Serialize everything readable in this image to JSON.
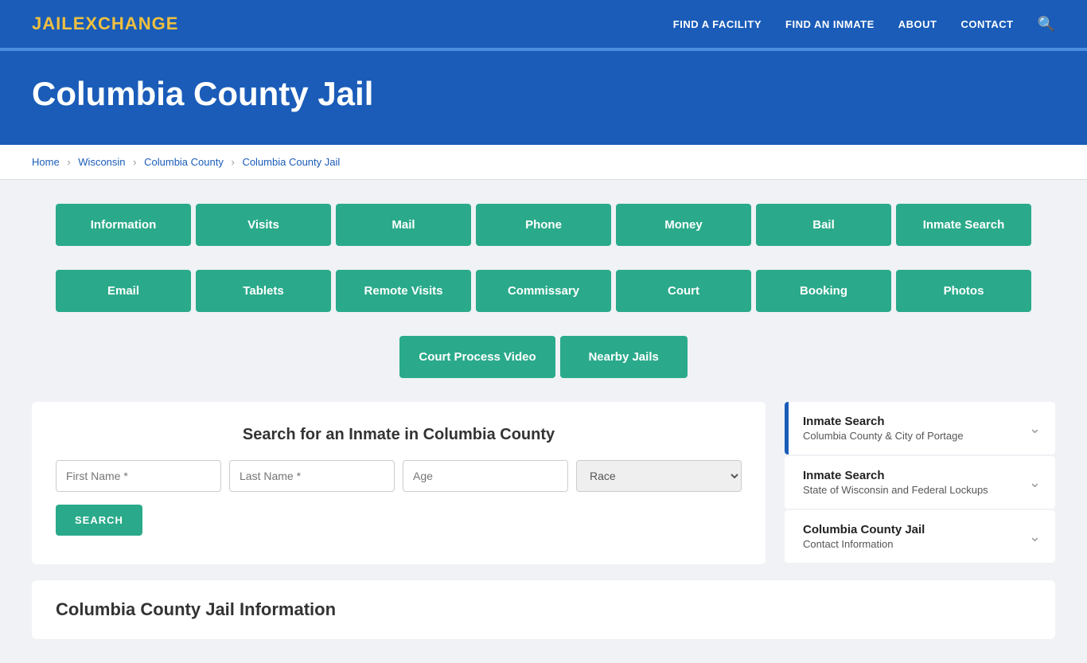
{
  "nav": {
    "logo_jail": "JAIL",
    "logo_exchange": "EXCHANGE",
    "links": [
      {
        "label": "FIND A FACILITY",
        "id": "find-facility"
      },
      {
        "label": "FIND AN INMATE",
        "id": "find-inmate"
      },
      {
        "label": "ABOUT",
        "id": "about"
      },
      {
        "label": "CONTACT",
        "id": "contact"
      }
    ]
  },
  "hero": {
    "title": "Columbia County Jail"
  },
  "breadcrumb": {
    "items": [
      {
        "label": "Home",
        "id": "home"
      },
      {
        "label": "Wisconsin",
        "id": "wisconsin"
      },
      {
        "label": "Columbia County",
        "id": "columbia-county"
      },
      {
        "label": "Columbia County Jail",
        "id": "columbia-county-jail"
      }
    ]
  },
  "buttons_row1": [
    {
      "label": "Information",
      "id": "btn-information"
    },
    {
      "label": "Visits",
      "id": "btn-visits"
    },
    {
      "label": "Mail",
      "id": "btn-mail"
    },
    {
      "label": "Phone",
      "id": "btn-phone"
    },
    {
      "label": "Money",
      "id": "btn-money"
    },
    {
      "label": "Bail",
      "id": "btn-bail"
    },
    {
      "label": "Inmate Search",
      "id": "btn-inmate-search"
    }
  ],
  "buttons_row2": [
    {
      "label": "Email",
      "id": "btn-email"
    },
    {
      "label": "Tablets",
      "id": "btn-tablets"
    },
    {
      "label": "Remote Visits",
      "id": "btn-remote-visits"
    },
    {
      "label": "Commissary",
      "id": "btn-commissary"
    },
    {
      "label": "Court",
      "id": "btn-court"
    },
    {
      "label": "Booking",
      "id": "btn-booking"
    },
    {
      "label": "Photos",
      "id": "btn-photos"
    }
  ],
  "buttons_row3": [
    {
      "label": "Court Process Video",
      "id": "btn-court-process-video"
    },
    {
      "label": "Nearby Jails",
      "id": "btn-nearby-jails"
    }
  ],
  "search": {
    "heading": "Search for an Inmate in Columbia County",
    "first_name_placeholder": "First Name *",
    "last_name_placeholder": "Last Name *",
    "age_placeholder": "Age",
    "race_placeholder": "Race",
    "button_label": "SEARCH"
  },
  "sidebar": {
    "cards": [
      {
        "main_title": "Inmate Search",
        "sub_title": "Columbia County & City of Portage",
        "active": true,
        "id": "sidebar-inmate-search-columbia"
      },
      {
        "main_title": "Inmate Search",
        "sub_title": "State of Wisconsin and Federal Lockups",
        "active": false,
        "id": "sidebar-inmate-search-state"
      },
      {
        "main_title": "Columbia County Jail",
        "sub_title": "Contact Information",
        "active": false,
        "id": "sidebar-contact-info"
      }
    ]
  },
  "bottom_section": {
    "heading": "Columbia County Jail Information"
  }
}
